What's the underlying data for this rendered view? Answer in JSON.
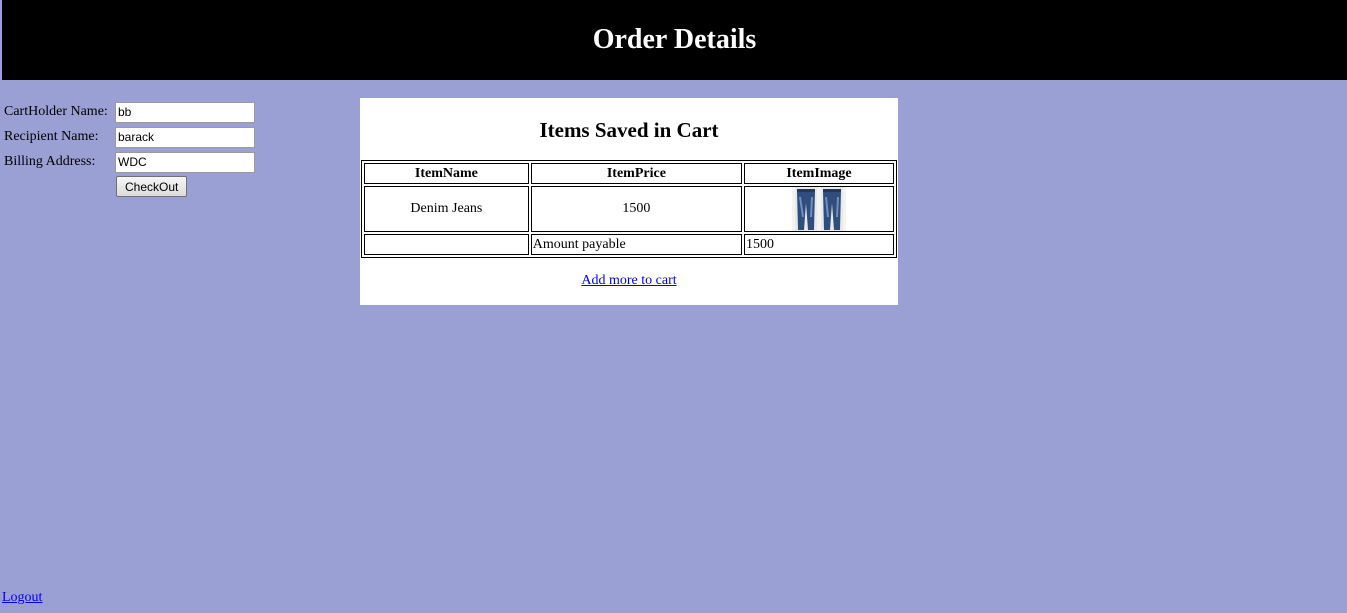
{
  "header": {
    "title": "Order Details"
  },
  "form": {
    "cardholder_label": "CartHolder Name:",
    "cardholder_value": "bb",
    "recipient_label": "Recipient Name:",
    "recipient_value": "barack",
    "billing_label": "Billing Address:",
    "billing_value": "WDC",
    "checkout_label": "CheckOut"
  },
  "cart": {
    "title": "Items Saved in Cart",
    "columns": [
      "ItemName",
      "ItemPrice",
      "ItemImage"
    ],
    "items": [
      {
        "name": "Denim Jeans",
        "price": "1500",
        "image_icon": "jeans-image"
      }
    ],
    "total_label": "Amount payable",
    "total_value": "1500",
    "add_more_link": "Add more to cart"
  },
  "footer": {
    "logout_link": "Logout"
  },
  "colors": {
    "background": "#9a9fd4",
    "header": "#000000",
    "panel": "#ffffff",
    "link": "#0000ee"
  }
}
